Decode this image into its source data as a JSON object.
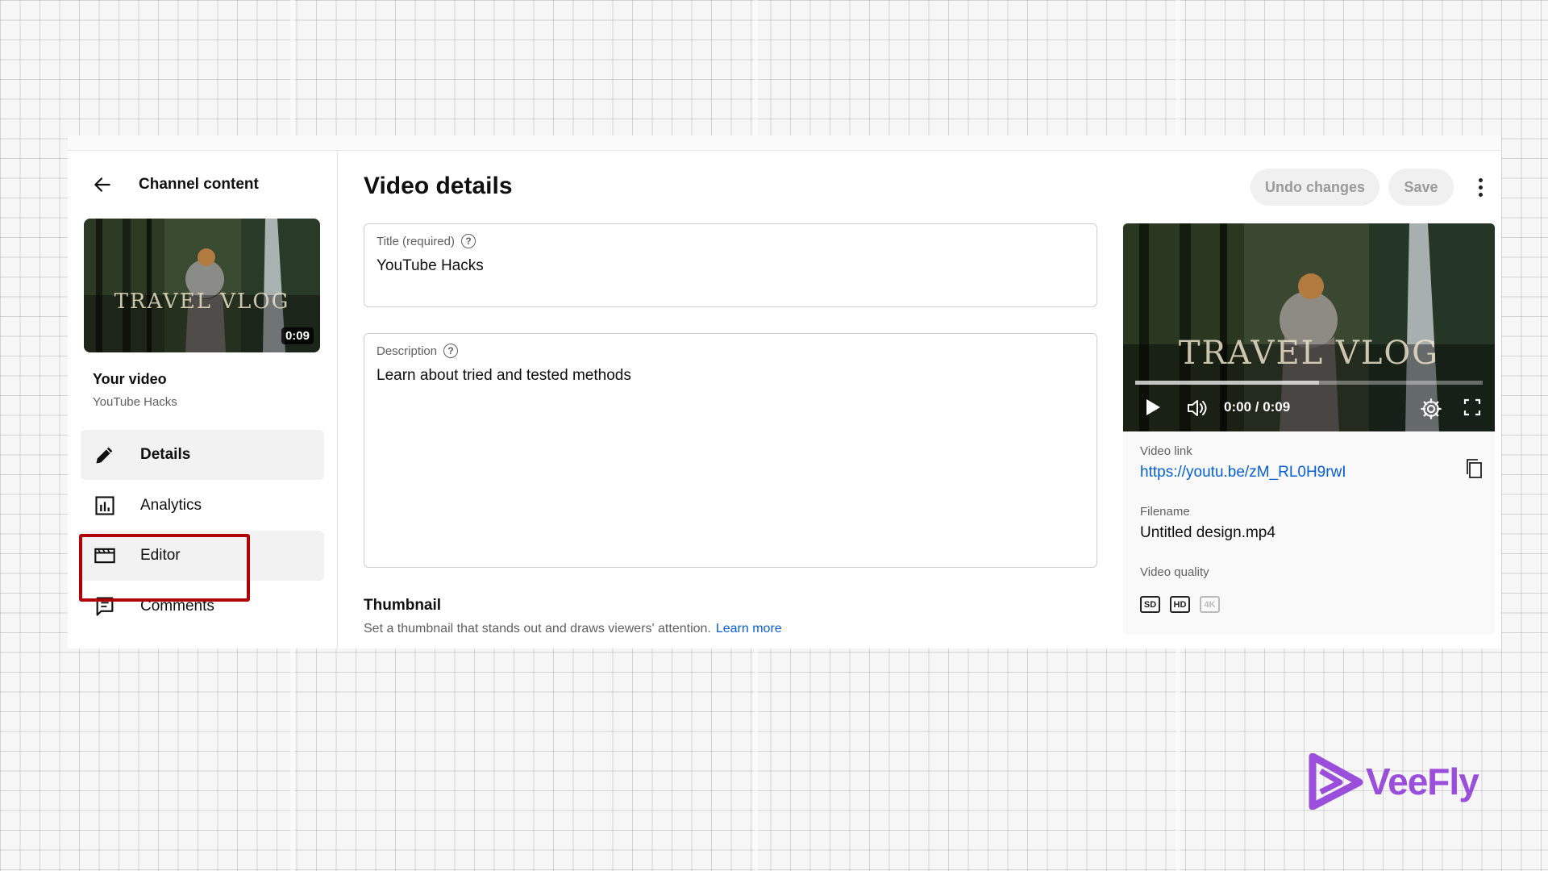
{
  "sidebar": {
    "back_label": "Channel content",
    "thumbnail_overlay": "TRAVEL VLOG",
    "duration": "0:09",
    "your_video_label": "Your video",
    "your_video_title": "YouTube Hacks",
    "nav": [
      {
        "label": "Details",
        "icon": "pencil-icon"
      },
      {
        "label": "Analytics",
        "icon": "analytics-icon"
      },
      {
        "label": "Editor",
        "icon": "editor-icon"
      },
      {
        "label": "Comments",
        "icon": "comments-icon"
      }
    ]
  },
  "header": {
    "title": "Video details",
    "undo_label": "Undo changes",
    "save_label": "Save"
  },
  "form": {
    "title_label": "Title (required)",
    "title_value": "YouTube Hacks",
    "description_label": "Description",
    "description_value": "Learn about tried and tested methods",
    "help_glyph": "?"
  },
  "thumbnail": {
    "heading": "Thumbnail",
    "description": "Set a thumbnail that stands out and draws viewers' attention.",
    "learn_more": "Learn more"
  },
  "player": {
    "overlay_text": "TRAVEL VLOG",
    "time": "0:00 / 0:09",
    "buffered_fraction": 0.53
  },
  "video_info": {
    "link_label": "Video link",
    "link_value": "https://youtu.be/zM_RL0H9rwI",
    "filename_label": "Filename",
    "filename_value": "Untitled design.mp4",
    "quality_label": "Video quality",
    "qualities": [
      "SD",
      "HD",
      "4K"
    ]
  },
  "brand": {
    "logo_text": "VeeFly",
    "color": "#9b4ddb"
  },
  "colors": {
    "highlight": "#b00008",
    "link": "#065fd4"
  }
}
